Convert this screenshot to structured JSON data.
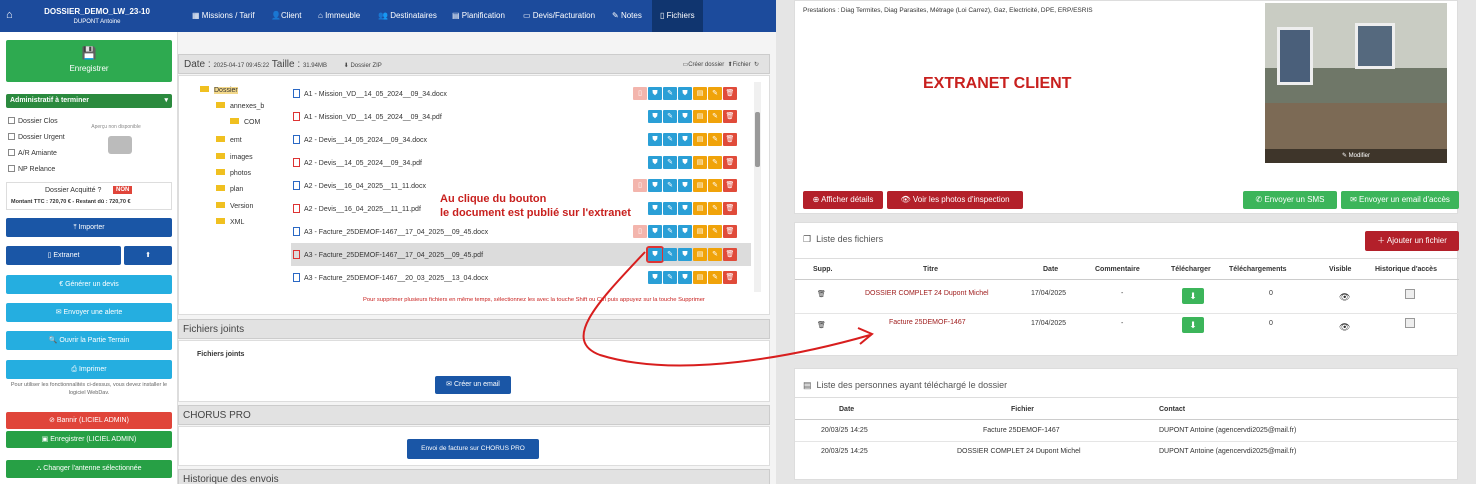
{
  "left": {
    "dossier_name": "DOSSIER_DEMO_LW_23-10",
    "dossier_owner": "DUPONT Antoine",
    "nav": [
      "Missions / Tarif",
      "Client",
      "Immeuble",
      "Destinataires",
      "Planification",
      "Devis/Facturation",
      "Notes",
      "Fichiers"
    ],
    "save_label": "Enregistrer",
    "status_select": "Administratif à terminer",
    "checkboxes": [
      "Dossier Clos",
      "Dossier Urgent",
      "A/R Amiante",
      "NP Relance"
    ],
    "preview_label": "Aperçu non disponible",
    "acquitte_label": "Dossier Acquitté ?",
    "acquitte_badge": "NON",
    "montant": "Montant TTC : 720,70 € - Restant dû : 720,70 €",
    "buttons": {
      "importer": "Importer",
      "extranet": "Extranet",
      "generer_devis": "Générer un devis",
      "envoyer_alerte": "Envoyer une alerte",
      "ouvrir_terrain": "Ouvrir la Partie Terrain",
      "imprimer": "Imprimer",
      "bannir": "Bannir (LICIEL ADMIN)",
      "enregistrer_admin": "Enregistrer (LICIEL ADMIN)",
      "changer_antenne": "Changer l'antenne sélectionnée"
    },
    "webdav_note": "Pour utiliser les fonctionnalités ci-dessus, vous devez installer le logiciel WebDav.",
    "files_header": {
      "date_label": "Date :",
      "date_value": "2025-04-17 09:45:22",
      "size_label": "Taille :",
      "size_value": "31.94MB",
      "zip": "Dossier ZIP",
      "create_folder": "Créer dossier",
      "file": "Fichier"
    },
    "tree": [
      "Dossier",
      "annexes_b",
      "COM",
      "emt",
      "images",
      "photos",
      "plan",
      "Version",
      "XML"
    ],
    "files": [
      {
        "name": "A1 - Mission_VD__14_05_2024__09_34.docx",
        "type": "docx"
      },
      {
        "name": "A1 - Mission_VD__14_05_2024__09_34.pdf",
        "type": "pdf"
      },
      {
        "name": "A2 - Devis__14_05_2024__09_34.docx",
        "type": "docx"
      },
      {
        "name": "A2 - Devis__14_05_2024__09_34.pdf",
        "type": "pdf"
      },
      {
        "name": "A2 - Devis__16_04_2025__11_11.docx",
        "type": "docx"
      },
      {
        "name": "A2 - Devis__16_04_2025__11_11.pdf",
        "type": "pdf"
      },
      {
        "name": "A3 - Facture_25DEMOF-1467__17_04_2025__09_45.docx",
        "type": "docx"
      },
      {
        "name": "A3 - Facture_25DEMOF-1467__17_04_2025__09_45.pdf",
        "type": "pdf"
      },
      {
        "name": "A3 - Facture_25DEMOF-1467__20_03_2025__13_04.docx",
        "type": "docx"
      }
    ],
    "annotation": "Au clique du bouton\nle document est publié sur l'extranet",
    "delete_hint": "Pour supprimer plusieurs fichiers en même temps, sélectionnez les avec la touche Shift ou Ctrl puis appuyez sur la touche Supprimer",
    "sections": {
      "fichiers_joints": "Fichiers joints",
      "fichiers_joints_sub": "Fichiers joints",
      "creer_email": "Créer un email",
      "chorus": "CHORUS PRO",
      "chorus_btn": "Envoi de facture sur CHORUS PRO",
      "historique": "Historique des envois"
    }
  },
  "right": {
    "prestations": "Prestations : Diag Termites, Diag Parasites, Métrage (Loi Carrez), Gaz, Electricité, DPE, ERP/ESRIS",
    "extranet_title": "EXTRANET CLIENT",
    "photo_modify": "Modifier",
    "btn_details": "Afficher détails",
    "btn_photos": "Voir les photos d'inspection",
    "btn_sms": "Envoyer un SMS",
    "btn_email": "Envoyer un email d'accès",
    "files_title": "Liste des fichiers",
    "add_file": "Ajouter un fichier",
    "columns": [
      "Supp.",
      "Titre",
      "Date",
      "Commentaire",
      "Télécharger",
      "Téléchargements",
      "Visible",
      "Historique d'accès"
    ],
    "rows": [
      {
        "title": "DOSSIER COMPLET 24 Dupont Michel",
        "date": "17/04/2025",
        "comment": "-",
        "downloads": "0"
      },
      {
        "title": "Facture 25DEMOF-1467",
        "date": "17/04/2025",
        "comment": "-",
        "downloads": "0"
      }
    ],
    "people_title": "Liste des personnes ayant téléchargé le dossier",
    "people_columns": [
      "Date",
      "Fichier",
      "Contact"
    ],
    "people": [
      {
        "date": "20/03/25 14:25",
        "file": "Facture 25DEMOF-1467",
        "contact": "DUPONT Antoine (agencervdi2025@mail.fr)"
      },
      {
        "date": "20/03/25 14:25",
        "file": "DOSSIER COMPLET 24 Dupont Michel",
        "contact": "DUPONT Antoine (agencervdi2025@mail.fr)"
      }
    ]
  },
  "colors": {
    "nav_blue": "#1c4b9c",
    "green": "#2eaa50",
    "cyan": "#25aee0",
    "red": "#e0453a",
    "dark_red": "#b3202a",
    "annotation": "#c8201e"
  }
}
